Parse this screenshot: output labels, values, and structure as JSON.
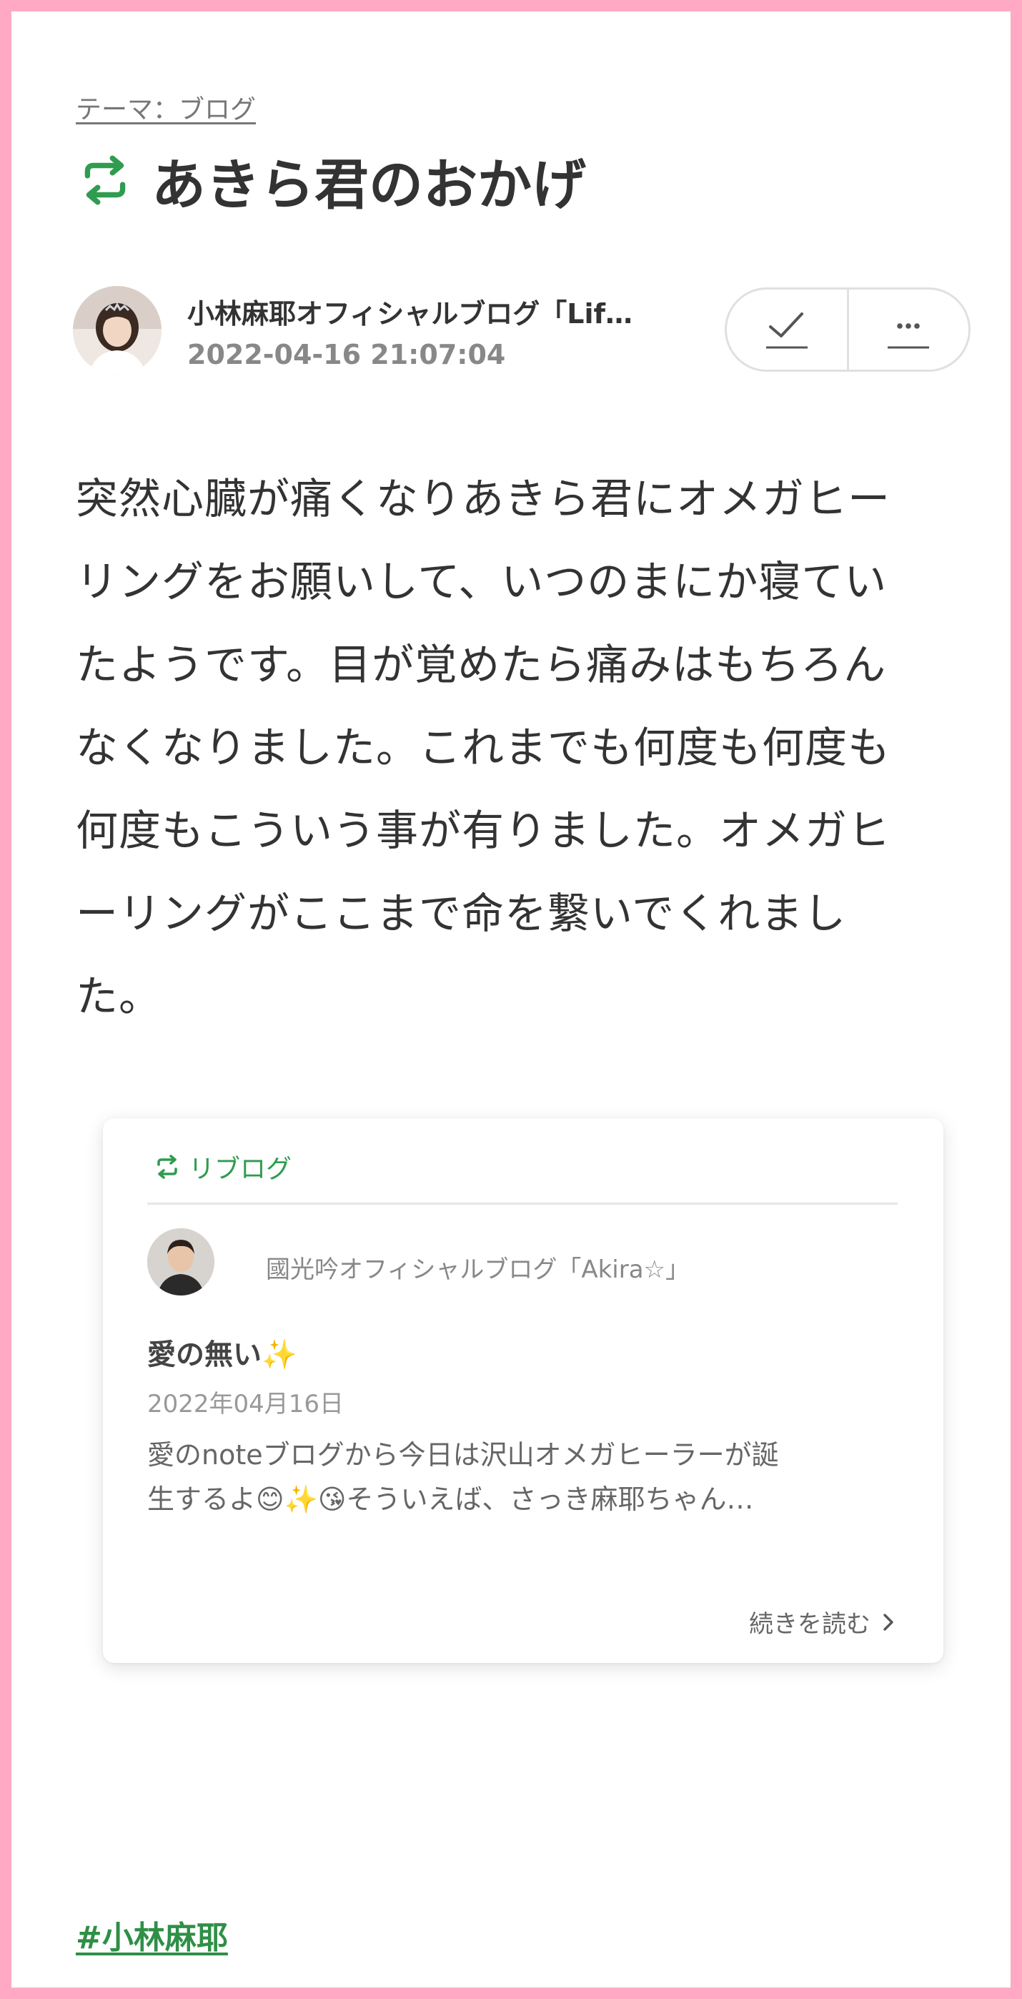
{
  "theme_link": "テーマ：ブログ",
  "title": "あきら君のおかげ",
  "author": {
    "name": "小林麻耶オフィシャルブログ「Lif…",
    "date": "2022-04-16 21:07:04"
  },
  "body_lines": [
    "突然心臓が痛くなりあきら君にオメガヒー",
    "リングをお願いして、いつのまにか寝てい",
    "たようです。目が覚めたら痛みはもちろん",
    "なくなりました。これまでも何度も何度も",
    "何度もこういう事が有りました。オメガヒ",
    "ーリングがここまで命を繋いでくれまし",
    "た。"
  ],
  "reblog_card": {
    "label": "リブログ",
    "author": "國光吟オフィシャルブログ「Akira☆」",
    "title": "愛の無い✨",
    "date": "2022年04月16日",
    "excerpt_lines": [
      "愛のnoteブログから今日は沢山オメガヒーラーが誕",
      "生するよ😊✨😘そういえば、さっき麻耶ちゃん…"
    ],
    "read_more": "続きを読む"
  },
  "hashtag": "#小林麻耶",
  "colors": {
    "frame": "#ffa9c4",
    "accent_green": "#2f9c50",
    "text": "#333333"
  },
  "icons": {
    "title": "reblog-icon",
    "like": "check-icon",
    "more": "more-icon",
    "read_more": "chevron-right-icon"
  }
}
